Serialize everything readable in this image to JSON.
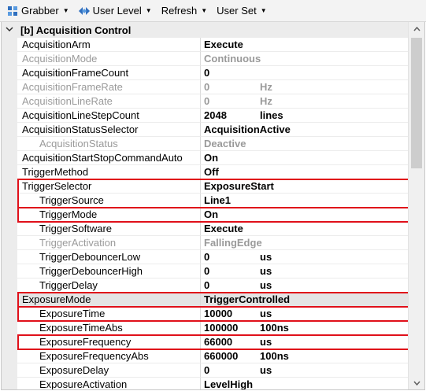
{
  "toolbar": {
    "items": [
      {
        "label": "Grabber",
        "icon": "grid-dots-icon"
      },
      {
        "label": "User Level",
        "icon": "diamond-arrows-icon"
      },
      {
        "label": "Refresh",
        "icon": ""
      },
      {
        "label": "User Set",
        "icon": ""
      }
    ]
  },
  "category": {
    "label": "[b] Acquisition Control",
    "expanded": true
  },
  "properties": [
    {
      "name": "AcquisitionArm",
      "value": "Execute",
      "unit": "",
      "disabled": false,
      "indent": false,
      "selected": false
    },
    {
      "name": "AcquisitionMode",
      "value": "Continuous",
      "unit": "",
      "disabled": true,
      "indent": false,
      "selected": false
    },
    {
      "name": "AcquisitionFrameCount",
      "value": "0",
      "unit": "",
      "disabled": false,
      "indent": false,
      "selected": false
    },
    {
      "name": "AcquisitionFrameRate",
      "value": "0",
      "unit": "Hz",
      "disabled": true,
      "indent": false,
      "selected": false
    },
    {
      "name": "AcquisitionLineRate",
      "value": "0",
      "unit": "Hz",
      "disabled": true,
      "indent": false,
      "selected": false
    },
    {
      "name": "AcquisitionLineStepCount",
      "value": "2048",
      "unit": "lines",
      "disabled": false,
      "indent": false,
      "selected": false
    },
    {
      "name": "AcquisitionStatusSelector",
      "value": "AcquisitionActive",
      "unit": "",
      "disabled": false,
      "indent": false,
      "selected": false
    },
    {
      "name": "AcquisitionStatus",
      "value": "Deactive",
      "unit": "",
      "disabled": true,
      "indent": true,
      "selected": false
    },
    {
      "name": "AcquisitionStartStopCommandAuto",
      "value": "On",
      "unit": "",
      "disabled": false,
      "indent": false,
      "selected": false
    },
    {
      "name": "TriggerMethod",
      "value": "Off",
      "unit": "",
      "disabled": false,
      "indent": false,
      "selected": false
    },
    {
      "name": "TriggerSelector",
      "value": "ExposureStart",
      "unit": "",
      "disabled": false,
      "indent": false,
      "selected": false
    },
    {
      "name": "TriggerSource",
      "value": "Line1",
      "unit": "",
      "disabled": false,
      "indent": true,
      "selected": false
    },
    {
      "name": "TriggerMode",
      "value": "On",
      "unit": "",
      "disabled": false,
      "indent": true,
      "selected": false
    },
    {
      "name": "TriggerSoftware",
      "value": "Execute",
      "unit": "",
      "disabled": false,
      "indent": true,
      "selected": false
    },
    {
      "name": "TriggerActivation",
      "value": "FallingEdge",
      "unit": "",
      "disabled": true,
      "indent": true,
      "selected": false
    },
    {
      "name": "TriggerDebouncerLow",
      "value": "0",
      "unit": "us",
      "disabled": false,
      "indent": true,
      "selected": false
    },
    {
      "name": "TriggerDebouncerHigh",
      "value": "0",
      "unit": "us",
      "disabled": false,
      "indent": true,
      "selected": false
    },
    {
      "name": "TriggerDelay",
      "value": "0",
      "unit": "us",
      "disabled": false,
      "indent": true,
      "selected": false
    },
    {
      "name": "ExposureMode",
      "value": "TriggerControlled",
      "unit": "",
      "disabled": false,
      "indent": false,
      "selected": true
    },
    {
      "name": "ExposureTime",
      "value": "10000",
      "unit": "us",
      "disabled": false,
      "indent": true,
      "selected": false
    },
    {
      "name": "ExposureTimeAbs",
      "value": "100000",
      "unit": "100ns",
      "disabled": false,
      "indent": true,
      "selected": false
    },
    {
      "name": "ExposureFrequency",
      "value": "66000",
      "unit": "us",
      "disabled": false,
      "indent": true,
      "selected": false
    },
    {
      "name": "ExposureFrequencyAbs",
      "value": "660000",
      "unit": "100ns",
      "disabled": false,
      "indent": true,
      "selected": false
    },
    {
      "name": "ExposureDelay",
      "value": "0",
      "unit": "us",
      "disabled": false,
      "indent": true,
      "selected": false
    },
    {
      "name": "ExposureActivation",
      "value": "LevelHigh",
      "unit": "",
      "disabled": false,
      "indent": true,
      "selected": false
    }
  ],
  "highlighted_rows": [
    [
      "TriggerSelector",
      "TriggerSource"
    ],
    [
      "TriggerMode"
    ],
    [
      "ExposureMode"
    ],
    [
      "ExposureTime"
    ],
    [
      "ExposureFrequency"
    ]
  ],
  "colors": {
    "highlight_border": "#e0101a",
    "disabled_text": "#9a9a9a",
    "gutter": "#ececec"
  }
}
